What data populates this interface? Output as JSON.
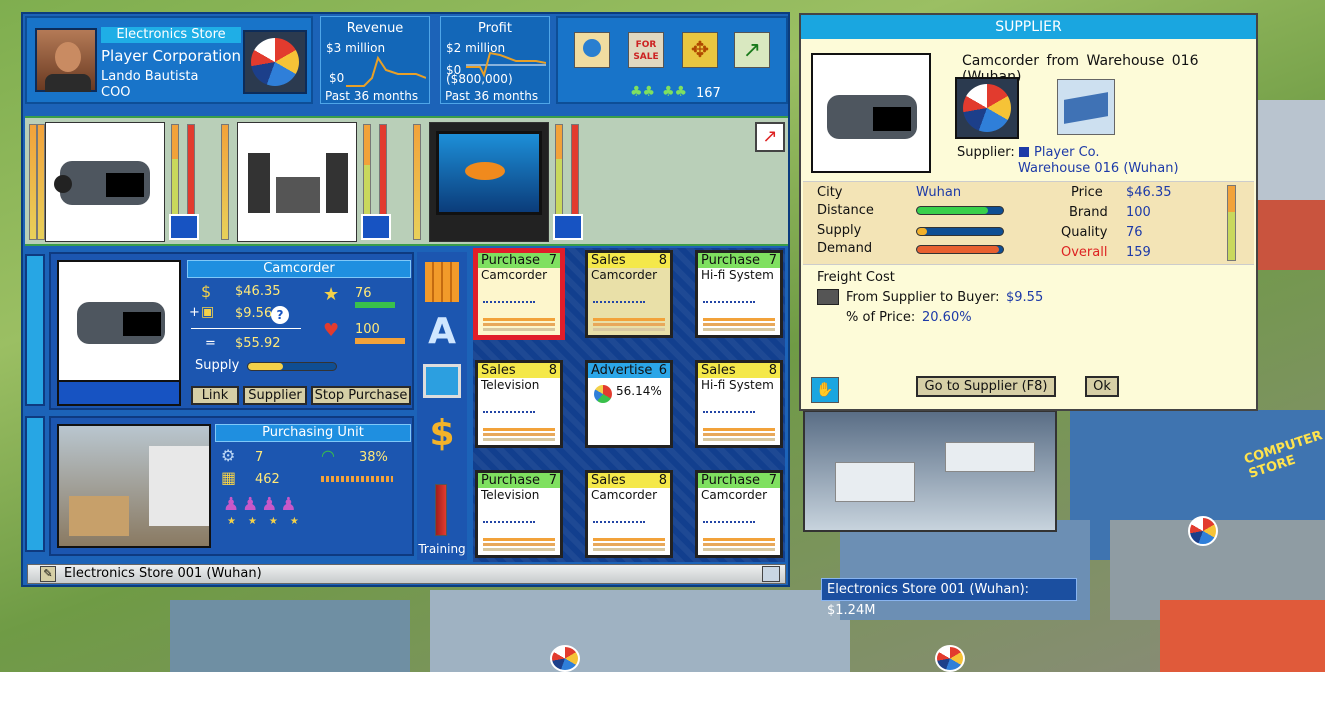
{
  "player": {
    "store_label": "Electronics Store",
    "company": "Player Corporation",
    "name": "Lando Bautista",
    "title": "COO"
  },
  "revenue": {
    "label": "Revenue",
    "top": "$3 million",
    "bottom": "$0",
    "period": "Past 36 months"
  },
  "profit": {
    "label": "Profit",
    "top": "$2 million",
    "mid": "$0",
    "bottom": "($800,000)",
    "period": "Past 36 months"
  },
  "toolbar": {
    "count": "167"
  },
  "product_panel": {
    "name": "Camcorder",
    "price": "$46.35",
    "freight": "$9.56",
    "help": "?",
    "equals": "=",
    "total": "$55.92",
    "plus": "+",
    "supply_label": "Supply",
    "quality": "76",
    "brand": "100",
    "buttons": [
      "Link",
      "Supplier",
      "Stop Purchase"
    ]
  },
  "purchasing_unit": {
    "title": "Purchasing Unit",
    "level": "7",
    "count": "462",
    "percent": "38%"
  },
  "side_tools": {
    "training": "Training"
  },
  "units": [
    {
      "type": "Purchase",
      "level": "7",
      "product": "Camcorder",
      "color": "#7fe060",
      "selected": true,
      "bg": "#fdf6cc"
    },
    {
      "type": "Sales",
      "level": "8",
      "product": "Camcorder",
      "color": "#f4e84a",
      "bg": "#e9e0a8"
    },
    {
      "type": "Purchase",
      "level": "7",
      "product": "Hi-fi System",
      "color": "#7fe060",
      "bg": "#ffffff"
    },
    {
      "type": "Sales",
      "level": "8",
      "product": "Television",
      "color": "#f4e84a",
      "bg": "#ffffff"
    },
    {
      "type": "Advertise",
      "level": "6",
      "product": "56.14%",
      "color": "#2ba6e8",
      "bg": "#ffffff"
    },
    {
      "type": "Sales",
      "level": "8",
      "product": "Hi-fi System",
      "color": "#f4e84a",
      "bg": "#ffffff"
    },
    {
      "type": "Purchase",
      "level": "7",
      "product": "Television",
      "color": "#7fe060",
      "bg": "#ffffff"
    },
    {
      "type": "Sales",
      "level": "8",
      "product": "Camcorder",
      "color": "#f4e84a",
      "bg": "#ffffff"
    },
    {
      "type": "Purchase",
      "level": "7",
      "product": "Camcorder",
      "color": "#7fe060",
      "bg": "#ffffff"
    }
  ],
  "status_bar": {
    "text": "Electronics Store 001 (Wuhan)"
  },
  "supplier": {
    "title": "SUPPLIER",
    "heading": "Camcorder from Warehouse 016 (Wuhan)",
    "supplier_label": "Supplier:",
    "supplier_company": "Player Co.",
    "supplier_site": "Warehouse 016 (Wuhan)",
    "city_label": "City",
    "city": "Wuhan",
    "distance_label": "Distance",
    "supply_label": "Supply",
    "demand_label": "Demand",
    "distance_level": 0.82,
    "supply_level": 0.12,
    "demand_level": 0.95,
    "price_label": "Price",
    "price": "$46.35",
    "brand_label": "Brand",
    "brand": "100",
    "quality_label": "Quality",
    "quality": "76",
    "overall_label": "Overall",
    "overall": "159",
    "freight_title": "Freight Cost",
    "freight_label": "From Supplier to Buyer:",
    "freight_value": "$9.55",
    "pct_label": "% of Price:",
    "pct_value": "20.60%",
    "go_button": "Go to Supplier (F8)",
    "ok_button": "Ok"
  },
  "world": {
    "tooltip": "Electronics Store 001 (Wuhan): $1.24M",
    "building_sign": "COMPUTER STORE"
  }
}
